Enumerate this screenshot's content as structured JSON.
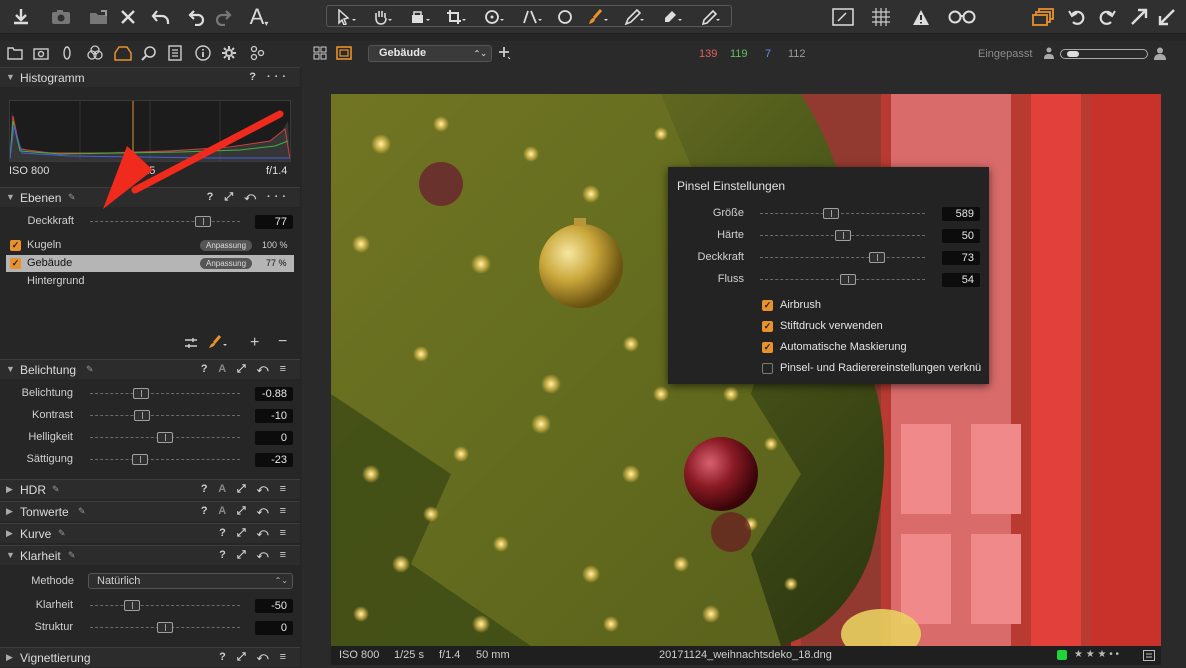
{
  "colors": {
    "accent": "#e8912d",
    "arrow": "#f02a1c",
    "toolbar": "#303030",
    "panel": "#262626"
  },
  "toolbar": {
    "left_icons": [
      "import-icon",
      "camera-icon",
      "export-icon",
      "delete-icon",
      "undo-icon",
      "undo-step-icon",
      "redo-step-icon",
      "text-icon"
    ],
    "text_tool": "A",
    "center_tools": [
      "select-icon",
      "hand-icon",
      "crop-box-icon",
      "crop-icon",
      "rotate-icon",
      "straighten-icon",
      "circle-icon",
      "brush-icon",
      "picker-icon",
      "eraser-icon",
      "pen-icon"
    ],
    "right_icons": [
      "edit-icon",
      "grid-icon",
      "warning-icon",
      "glasses-icon",
      "stack-icon",
      "rotate-left-icon",
      "rotate-right-icon",
      "expand-icon",
      "collapse-icon"
    ]
  },
  "subbar": {
    "layer_select": "Gebäude",
    "rgb": {
      "r": "139",
      "g": "119",
      "b": "7",
      "a": "112"
    },
    "zoom_label": "Eingepasst"
  },
  "histogram": {
    "title": "Histogramm",
    "help": "?",
    "iso": "ISO 800",
    "shutter": "1/25",
    "aperture": "f/1.4"
  },
  "ebenen": {
    "title": "Ebenen",
    "opacity_label": "Deckkraft",
    "opacity_value": "77",
    "layers": [
      {
        "name": "Kugeln",
        "badge": "Anpassung",
        "pct": "100 %",
        "checked": true
      },
      {
        "name": "Gebäude",
        "badge": "Anpassung",
        "pct": "77 %",
        "checked": true
      },
      {
        "name": "Hintergrund",
        "badge": "",
        "pct": "",
        "checked": false
      }
    ]
  },
  "belichtung": {
    "title": "Belichtung",
    "auto": "A",
    "rows": [
      {
        "label": "Belichtung",
        "value": "-0.88",
        "pos": 0.32
      },
      {
        "label": "Kontrast",
        "value": "-10",
        "pos": 0.33
      },
      {
        "label": "Helligkeit",
        "value": "0",
        "pos": 0.5
      },
      {
        "label": "Sättigung",
        "value": "-23",
        "pos": 0.31
      }
    ]
  },
  "collapsed": [
    {
      "title": "HDR"
    },
    {
      "title": "Tonwerte"
    },
    {
      "title": "Kurve"
    }
  ],
  "klarheit": {
    "title": "Klarheit",
    "method_label": "Methode",
    "method_value": "Natürlich",
    "rows": [
      {
        "label": "Klarheit",
        "value": "-50",
        "pos": 0.25
      },
      {
        "label": "Struktur",
        "value": "0",
        "pos": 0.5
      }
    ]
  },
  "vignettierung": {
    "title": "Vignettierung"
  },
  "popup": {
    "title": "Pinsel Einstellungen",
    "rows": [
      {
        "label": "Größe",
        "value": "589",
        "pos": 0.42
      },
      {
        "label": "Härte",
        "value": "50",
        "pos": 0.5
      },
      {
        "label": "Deckkraft",
        "value": "73",
        "pos": 0.73
      },
      {
        "label": "Fluss",
        "value": "54",
        "pos": 0.54
      }
    ],
    "options": [
      {
        "label": "Airbrush",
        "checked": true
      },
      {
        "label": "Stiftdruck verwenden",
        "checked": true
      },
      {
        "label": "Automatische Maskierung",
        "checked": true
      },
      {
        "label": "Pinsel- und Radierereinstellungen verknü",
        "checked": false
      }
    ]
  },
  "status": {
    "iso": "ISO 800",
    "shutter": "1/25 s",
    "aperture": "f/1.4",
    "focal": "50 mm",
    "filename": "20171124_weihnachtsdeko_18.dng",
    "stars": "★ ★ ★ • •"
  }
}
